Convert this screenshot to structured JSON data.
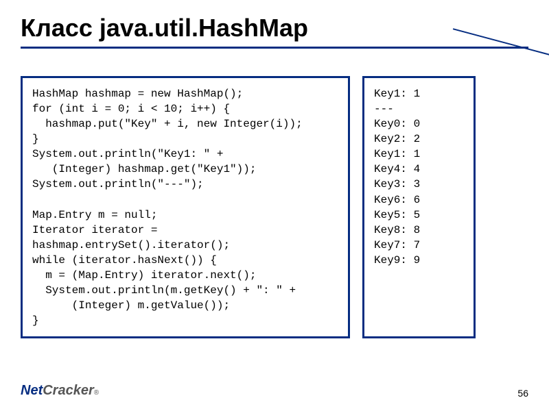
{
  "title": "Класс java.util.HashMap",
  "code_left": "HashMap hashmap = new HashMap();\nfor (int i = 0; i < 10; i++) {\n  hashmap.put(\"Key\" + i, new Integer(i));\n}\nSystem.out.println(\"Key1: \" +\n   (Integer) hashmap.get(\"Key1\"));\nSystem.out.println(\"---\");\n\nMap.Entry m = null;\nIterator iterator =\nhashmap.entrySet().iterator();\nwhile (iterator.hasNext()) {\n  m = (Map.Entry) iterator.next();\n  System.out.println(m.getKey() + \": \" +\n      (Integer) m.getValue());\n}",
  "code_right": "Key1: 1\n---\nKey0: 0\nKey2: 2\nKey1: 1\nKey4: 4\nKey3: 3\nKey6: 6\nKey5: 5\nKey8: 8\nKey7: 7\nKey9: 9",
  "logo": {
    "part1": "Net",
    "part2": "Cracker",
    "reg": "®"
  },
  "page_number": "56"
}
